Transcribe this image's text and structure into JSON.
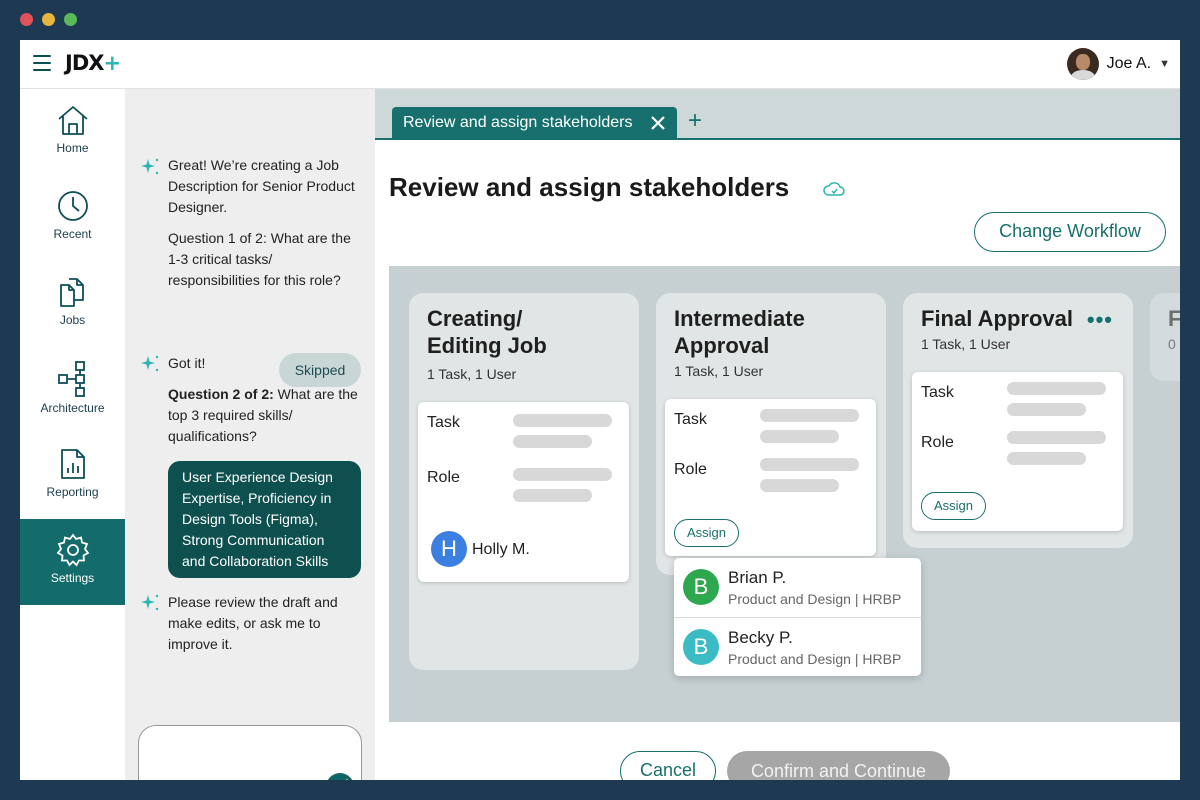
{
  "window_controls": [
    {
      "name": "close-dot",
      "color": "#e0525a"
    },
    {
      "name": "minimize-dot",
      "color": "#e7b53f"
    },
    {
      "name": "maximize-dot",
      "color": "#5cb95a"
    }
  ],
  "header": {
    "logo_text": "JDX",
    "logo_plus": "+",
    "user_name": "Joe A.",
    "caret": "▼"
  },
  "sidebar": {
    "items": [
      {
        "label": "Home",
        "icon": "home-icon"
      },
      {
        "label": "Recent",
        "icon": "clock-icon"
      },
      {
        "label": "Jobs",
        "icon": "documents-icon"
      },
      {
        "label": "Architecture",
        "icon": "hierarchy-icon"
      },
      {
        "label": "Reporting",
        "icon": "report-icon"
      },
      {
        "label": "Settings",
        "icon": "gear-icon",
        "active": true
      }
    ]
  },
  "chat": {
    "msg1": "Great! We’re creating a Job Description for Senior Product Designer.",
    "msg2": "Question 1 of 2: What are the 1-3 critical tasks/ responsibilities for this role?",
    "skipped": "Skipped",
    "msg3": "Got it!",
    "msg4_bold": "Question 2 of 2:",
    "msg4_rest": " What are the top 3 required skills/ qualifications?",
    "user_reply": "User Experience Design Expertise, Proficiency in Design Tools (Figma), Strong Communication and Collaboration Skills",
    "msg5": "Please review the draft and make edits, or ask me to improve it.",
    "input_value": ""
  },
  "tabs": {
    "active_label": "Review and assign stakeholders",
    "add_label": "+"
  },
  "page": {
    "title": "Review and assign stakeholders",
    "change_workflow": "Change Workflow"
  },
  "columns": [
    {
      "title_line1": "Creating/",
      "title_line2": "Editing Job",
      "subtitle": "1 Task, 1 User",
      "task_label": "Task",
      "role_label": "Role",
      "assignee_initial": "H",
      "assignee_name": "Holly M.",
      "assignee_color": "#3b7fe0"
    },
    {
      "title_line1": "Intermediate",
      "title_line2": "Approval",
      "subtitle": "1 Task, 1 User",
      "task_label": "Task",
      "role_label": "Role",
      "assign_label": "Assign"
    },
    {
      "title_line1": "Final Approval",
      "subtitle": "1 Task, 1 User",
      "task_label": "Task",
      "role_label": "Role",
      "assign_label": "Assign",
      "menu": "•••"
    },
    {
      "title_line1": "F",
      "subtitle": "0"
    }
  ],
  "dropdown": [
    {
      "initial": "B",
      "name": "Brian P.",
      "dept": "Product and Design | HRBP",
      "color": "#2ea84e"
    },
    {
      "initial": "B",
      "name": "Becky P.",
      "dept": "Product and Design | HRBP",
      "color": "#3bbcc4"
    }
  ],
  "footer": {
    "cancel": "Cancel",
    "confirm": "Confirm and Continue"
  }
}
